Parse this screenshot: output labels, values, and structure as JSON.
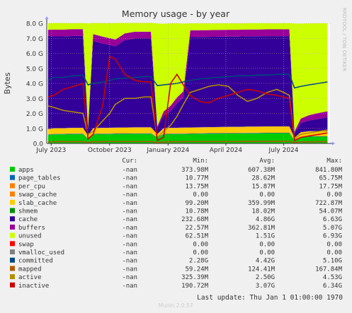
{
  "chart_data": {
    "type": "area",
    "title": "Memory usage - by year",
    "ylabel": "Bytes",
    "side_label": "RRDTOOL / TOBI OETIKER",
    "ylim": [
      0,
      8.0
    ],
    "y_unit": "G",
    "y_ticks": [
      0,
      1,
      2,
      3,
      4,
      5,
      6,
      7,
      8
    ],
    "y_tick_labels": [
      "0.0",
      "1.0 G",
      "2.0 G",
      "3.0 G",
      "4.0 G",
      "5.0 G",
      "6.0 G",
      "7.0 G",
      "8.0 G"
    ],
    "x_ticks": [
      "2023-07-01",
      "2023-10-01",
      "2024-01-01",
      "2024-04-01",
      "2024-07-01"
    ],
    "x_tick_labels": [
      "July 2023",
      "October 2023",
      "January 2024",
      "April 2024",
      "July 2024"
    ],
    "x_range": [
      "2023-06-24",
      "2024-09-12"
    ],
    "grid": true,
    "x": [
      "2023-06-26",
      "2023-07-05",
      "2023-07-20",
      "2023-08-05",
      "2023-08-20",
      "2023-08-28",
      "2023-09-05",
      "2023-09-20",
      "2023-10-01",
      "2023-10-10",
      "2023-10-25",
      "2023-11-10",
      "2023-11-25",
      "2023-12-05",
      "2023-12-15",
      "2023-12-25",
      "2024-01-05",
      "2024-01-15",
      "2024-01-25",
      "2024-02-05",
      "2024-02-20",
      "2024-03-05",
      "2024-03-20",
      "2024-04-05",
      "2024-04-20",
      "2024-05-05",
      "2024-05-20",
      "2024-06-05",
      "2024-06-20",
      "2024-07-01",
      "2024-07-10",
      "2024-07-18",
      "2024-07-28",
      "2024-08-10",
      "2024-08-25",
      "2024-09-08"
    ],
    "stack_series": [
      {
        "name": "apps",
        "color": "#00cc00",
        "values": [
          0.55,
          0.6,
          0.6,
          0.62,
          0.62,
          0.3,
          0.6,
          0.62,
          0.62,
          0.63,
          0.63,
          0.64,
          0.64,
          0.64,
          0.4,
          0.6,
          0.62,
          0.62,
          0.62,
          0.63,
          0.64,
          0.65,
          0.65,
          0.66,
          0.66,
          0.67,
          0.67,
          0.68,
          0.68,
          0.68,
          0.68,
          0.2,
          0.4,
          0.45,
          0.45,
          0.45
        ]
      },
      {
        "name": "page_tables",
        "color": "#0066b3",
        "values": [
          0.03,
          0.03,
          0.03,
          0.03,
          0.03,
          0.01,
          0.03,
          0.03,
          0.03,
          0.03,
          0.03,
          0.03,
          0.03,
          0.03,
          0.01,
          0.03,
          0.03,
          0.03,
          0.03,
          0.03,
          0.03,
          0.03,
          0.03,
          0.03,
          0.03,
          0.03,
          0.03,
          0.03,
          0.03,
          0.03,
          0.03,
          0.01,
          0.02,
          0.02,
          0.02,
          0.02
        ]
      },
      {
        "name": "per_cpu",
        "color": "#ff8000",
        "values": [
          0.02,
          0.02,
          0.02,
          0.02,
          0.02,
          0.01,
          0.02,
          0.02,
          0.02,
          0.02,
          0.02,
          0.02,
          0.02,
          0.02,
          0.01,
          0.02,
          0.02,
          0.02,
          0.02,
          0.02,
          0.02,
          0.02,
          0.02,
          0.02,
          0.02,
          0.02,
          0.02,
          0.02,
          0.02,
          0.02,
          0.02,
          0.01,
          0.02,
          0.02,
          0.02,
          0.02
        ]
      },
      {
        "name": "slab_cache",
        "color": "#ffcc00",
        "values": [
          0.35,
          0.36,
          0.36,
          0.37,
          0.37,
          0.2,
          0.36,
          0.37,
          0.37,
          0.37,
          0.38,
          0.38,
          0.38,
          0.38,
          0.2,
          0.36,
          0.37,
          0.37,
          0.38,
          0.38,
          0.38,
          0.38,
          0.39,
          0.39,
          0.39,
          0.4,
          0.4,
          0.4,
          0.4,
          0.4,
          0.4,
          0.15,
          0.3,
          0.32,
          0.32,
          0.33
        ]
      },
      {
        "name": "shmem",
        "color": "#330099",
        "values": [
          0.02,
          0.02,
          0.02,
          0.02,
          0.02,
          0.01,
          0.02,
          0.02,
          0.02,
          0.02,
          0.02,
          0.02,
          0.02,
          0.02,
          0.01,
          0.02,
          0.02,
          0.02,
          0.02,
          0.02,
          0.02,
          0.02,
          0.02,
          0.02,
          0.02,
          0.02,
          0.02,
          0.02,
          0.02,
          0.02,
          0.02,
          0.01,
          0.02,
          0.02,
          0.02,
          0.02
        ]
      },
      {
        "name": "cache",
        "color": "#330099",
        "values": [
          6.2,
          6.1,
          6.1,
          6.1,
          6.1,
          0.4,
          5.8,
          5.6,
          5.5,
          5.4,
          5.8,
          5.9,
          5.9,
          5.9,
          0.4,
          0.8,
          1.1,
          1.6,
          2.0,
          6.0,
          6.0,
          6.0,
          6.0,
          6.0,
          6.0,
          6.0,
          6.0,
          6.0,
          6.0,
          6.0,
          6.0,
          0.3,
          0.6,
          0.7,
          0.8,
          0.9
        ]
      },
      {
        "name": "buffers",
        "color": "#990099",
        "values": [
          0.4,
          0.45,
          0.45,
          0.45,
          0.45,
          0.1,
          0.45,
          0.45,
          0.45,
          0.45,
          0.45,
          0.45,
          0.45,
          0.45,
          0.1,
          0.3,
          0.35,
          0.4,
          0.4,
          0.45,
          0.45,
          0.45,
          0.45,
          0.45,
          0.45,
          0.45,
          0.45,
          0.45,
          0.45,
          0.45,
          0.45,
          0.1,
          0.3,
          0.35,
          0.4,
          0.4
        ]
      },
      {
        "name": "unused",
        "color": "#ccff00",
        "values": [
          0.43,
          0.44,
          0.44,
          0.41,
          0.41,
          6.96,
          0.74,
          0.91,
          1.01,
          1.1,
          0.69,
          0.59,
          0.59,
          0.59,
          6.86,
          5.84,
          5.49,
          4.94,
          4.51,
          0.47,
          0.46,
          0.45,
          0.44,
          0.43,
          0.43,
          0.42,
          0.42,
          0.41,
          0.41,
          0.41,
          0.41,
          7.21,
          6.32,
          6.12,
          5.97,
          5.86
        ]
      }
    ],
    "line_series": [
      {
        "name": "committed",
        "color": "#00487d",
        "values": [
          4.2,
          4.4,
          4.4,
          4.5,
          4.55,
          3.9,
          4.0,
          4.1,
          4.2,
          4.3,
          4.35,
          4.4,
          4.45,
          4.45,
          3.85,
          3.9,
          3.95,
          4.0,
          4.1,
          4.2,
          4.3,
          4.35,
          4.4,
          4.45,
          4.5,
          4.5,
          4.55,
          4.55,
          4.6,
          4.6,
          4.6,
          3.7,
          3.8,
          3.9,
          4.0,
          4.1
        ]
      },
      {
        "name": "mapped",
        "color": "#b35a00",
        "values": [
          0.1,
          0.12,
          0.12,
          0.12,
          0.12,
          0.06,
          0.12,
          0.12,
          0.13,
          0.13,
          0.13,
          0.13,
          0.13,
          0.13,
          0.06,
          0.11,
          0.12,
          0.12,
          0.12,
          0.13,
          0.13,
          0.13,
          0.13,
          0.13,
          0.13,
          0.14,
          0.14,
          0.14,
          0.14,
          0.14,
          0.14,
          0.06,
          0.1,
          0.11,
          0.12,
          0.12
        ]
      },
      {
        "name": "active",
        "color": "#b38f00",
        "values": [
          2.5,
          2.4,
          2.2,
          2.1,
          2.0,
          0.6,
          0.8,
          1.5,
          2.0,
          2.6,
          3.0,
          3.0,
          3.1,
          3.1,
          0.4,
          0.8,
          1.2,
          1.8,
          2.6,
          3.4,
          3.6,
          3.8,
          3.9,
          3.8,
          3.2,
          2.8,
          3.0,
          3.4,
          3.6,
          3.4,
          3.2,
          0.3,
          0.6,
          0.7,
          0.8,
          0.9
        ]
      },
      {
        "name": "inactive",
        "color": "#cc0000",
        "values": [
          3.1,
          3.2,
          3.6,
          3.8,
          4.0,
          0.3,
          0.6,
          2.5,
          5.8,
          5.6,
          4.6,
          4.2,
          4.1,
          4.1,
          0.2,
          0.4,
          4.0,
          4.6,
          3.9,
          3.2,
          2.8,
          2.7,
          3.0,
          3.2,
          3.4,
          3.6,
          3.5,
          3.3,
          3.2,
          3.1,
          3.0,
          0.2,
          0.4,
          0.5,
          0.6,
          0.7
        ]
      }
    ],
    "legend_header": {
      "cur": "Cur:",
      "min": "Min:",
      "avg": "Avg:",
      "max": "Max:"
    },
    "legend": [
      {
        "name": "apps",
        "color": "#00cc00",
        "cur": "-nan",
        "min": "373.98M",
        "avg": "607.38M",
        "max": "841.80M"
      },
      {
        "name": "page_tables",
        "color": "#0066b3",
        "cur": "-nan",
        "min": "10.77M",
        "avg": "28.62M",
        "max": "65.75M"
      },
      {
        "name": "per_cpu",
        "color": "#ff8000",
        "cur": "-nan",
        "min": "13.75M",
        "avg": "15.87M",
        "max": "17.75M"
      },
      {
        "name": "swap_cache",
        "color": "#ff8000",
        "cur": "-nan",
        "min": "0.00",
        "avg": "0.00",
        "max": "0.00"
      },
      {
        "name": "slab_cache",
        "color": "#ffcc00",
        "cur": "-nan",
        "min": "99.20M",
        "avg": "359.99M",
        "max": "722.87M"
      },
      {
        "name": "shmem",
        "color": "#008f00",
        "cur": "-nan",
        "min": "10.78M",
        "avg": "18.02M",
        "max": "54.07M"
      },
      {
        "name": "cache",
        "color": "#330099",
        "cur": "-nan",
        "min": "232.68M",
        "avg": "4.86G",
        "max": "6.63G"
      },
      {
        "name": "buffers",
        "color": "#990099",
        "cur": "-nan",
        "min": "22.57M",
        "avg": "362.81M",
        "max": "5.07G"
      },
      {
        "name": "unused",
        "color": "#ccff00",
        "cur": "-nan",
        "min": "62.51M",
        "avg": "1.51G",
        "max": "6.93G"
      },
      {
        "name": "swap",
        "color": "#ff0000",
        "cur": "-nan",
        "min": "0.00",
        "avg": "0.00",
        "max": "0.00"
      },
      {
        "name": "vmalloc_used",
        "color": "#808080",
        "cur": "-nan",
        "min": "0.00",
        "avg": "0.00",
        "max": "0.00"
      },
      {
        "name": "committed",
        "color": "#00487d",
        "cur": "-nan",
        "min": "2.28G",
        "avg": "4.42G",
        "max": "5.10G"
      },
      {
        "name": "mapped",
        "color": "#b35a00",
        "cur": "-nan",
        "min": "59.24M",
        "avg": "124.41M",
        "max": "167.84M"
      },
      {
        "name": "active",
        "color": "#b38f00",
        "cur": "-nan",
        "min": "325.39M",
        "avg": "2.50G",
        "max": "4.53G"
      },
      {
        "name": "inactive",
        "color": "#cc0000",
        "cur": "-nan",
        "min": "190.72M",
        "avg": "3.07G",
        "max": "6.34G"
      }
    ],
    "last_update": "Last update: Thu Jan  1 01:00:00 1970",
    "footer": "Munin 2.0.57"
  }
}
